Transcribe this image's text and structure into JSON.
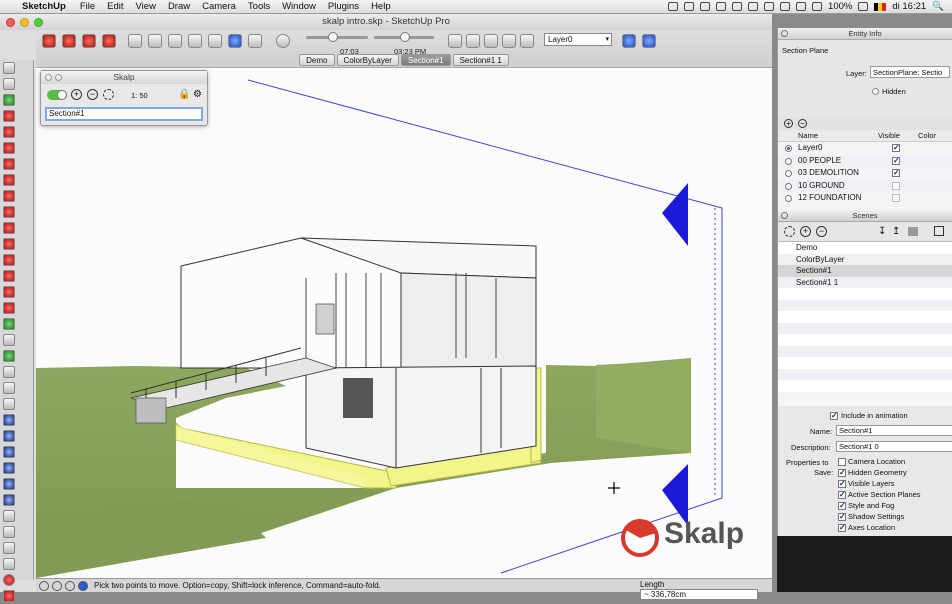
{
  "menubar": {
    "app_name": "SketchUp",
    "items": [
      "File",
      "Edit",
      "View",
      "Draw",
      "Camera",
      "Tools",
      "Window",
      "Plugins",
      "Help"
    ],
    "battery": "100%",
    "clock": "di 16:21"
  },
  "window": {
    "title": "skalp intro.skp - SketchUp Pro"
  },
  "toolbar": {
    "time_start": "07:03",
    "time_end": "03:23 PM",
    "layer_select": "Layer0"
  },
  "scene_tabs": [
    "Demo",
    "ColorByLayer",
    "Section#1",
    "Section#1 1"
  ],
  "scene_tabs_active": "Section#1",
  "skalp_panel": {
    "title": "Skalp",
    "scale": "1: 50",
    "section_name": "Section#1"
  },
  "viewport": {
    "watermark": "Skalp"
  },
  "statusbar": {
    "hint": "Pick two points to move.  Option=copy, Shift=lock inference, Command=auto-fold.",
    "length_label": "Length",
    "length_value": "~ 336,78cm"
  },
  "entity_info": {
    "title": "Entity Info",
    "entity": "Section Plane",
    "layer_label": "Layer:",
    "layer_value": "SectionPlane: Sectio",
    "hidden_label": "Hidden"
  },
  "layers": {
    "col_name": "Name",
    "col_visible": "Visible",
    "col_color": "Color",
    "rows": [
      {
        "name": "Layer0",
        "active": true,
        "visible": true
      },
      {
        "name": "00 PEOPLE",
        "active": false,
        "visible": true
      },
      {
        "name": "03 DEMOLITION",
        "active": false,
        "visible": true
      },
      {
        "name": "10 GROUND",
        "active": false,
        "visible": false
      },
      {
        "name": "12 FOUNDATION",
        "active": false,
        "visible": false
      }
    ]
  },
  "scenes": {
    "title": "Scenes",
    "items": [
      "Demo",
      "ColorByLayer",
      "Section#1",
      "Section#1 1"
    ],
    "selected": "Section#1"
  },
  "scene_props": {
    "include_label": "Include in animation",
    "name_label": "Name:",
    "name_value": "Section#1",
    "desc_label": "Description:",
    "desc_value": "Section#1 0",
    "props_label": "Properties to",
    "save_label": "Save:",
    "options": [
      "Camera Location",
      "Hidden Geometry",
      "Visible Layers",
      "Active Section Planes",
      "Style and Fog",
      "Shadow Settings",
      "Axes Location"
    ],
    "options_checked": [
      false,
      true,
      true,
      true,
      true,
      true,
      true
    ]
  },
  "colors": {
    "grass": "#8ba45a",
    "section_arrow": "#1a1ad8",
    "section_highlight": "#f2f58a",
    "skalp_red": "#d73a2c"
  }
}
